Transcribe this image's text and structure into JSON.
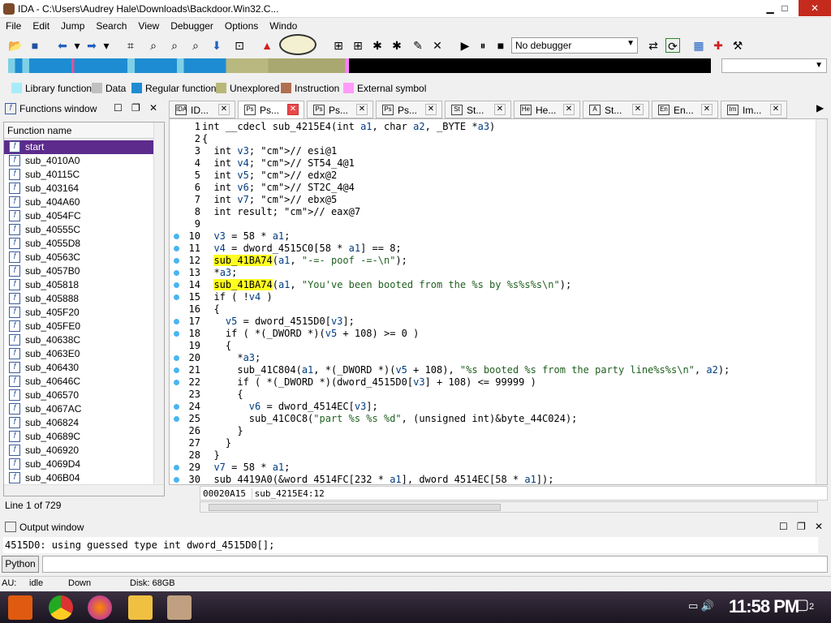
{
  "window": {
    "title": "IDA - C:\\Users\\Audrey Hale\\Downloads\\Backdoor.Win32.C...",
    "min": "▁",
    "max": "□",
    "close": "✕"
  },
  "menu": [
    "File",
    "Edit",
    "Jump",
    "Search",
    "View",
    "Debugger",
    "Options",
    "Windo"
  ],
  "toolbar": {
    "debugger": "No debugger"
  },
  "legend": [
    {
      "label": "Library function",
      "color": "#a8ecf8"
    },
    {
      "label": "Data",
      "color": "#c0c0c0"
    },
    {
      "label": "Regular function",
      "color": "#1e8cd2"
    },
    {
      "label": "Unexplored",
      "color": "#b8b878"
    },
    {
      "label": "Instruction",
      "color": "#b07050"
    },
    {
      "label": "External symbol",
      "color": "#ff9cf8"
    }
  ],
  "functions": {
    "title": "Functions window",
    "header": "Function name",
    "items": [
      "start",
      "sub_4010A0",
      "sub_40115C",
      "sub_403164",
      "sub_404A60",
      "sub_4054FC",
      "sub_40555C",
      "sub_4055D8",
      "sub_40563C",
      "sub_4057B0",
      "sub_405818",
      "sub_405888",
      "sub_405F20",
      "sub_405FE0",
      "sub_40638C",
      "sub_4063E0",
      "sub_406430",
      "sub_40646C",
      "sub_406570",
      "sub_4067AC",
      "sub_406824",
      "sub_40689C",
      "sub_406920",
      "sub_4069D4",
      "sub_406B04"
    ],
    "status": "Line 1 of 729"
  },
  "tabs": [
    {
      "label": "ID...",
      "icon": "IDA"
    },
    {
      "label": "Ps...",
      "icon": "Ps",
      "active": true
    },
    {
      "label": "Ps...",
      "icon": "Ps"
    },
    {
      "label": "Ps...",
      "icon": "Ps"
    },
    {
      "label": "St...",
      "icon": "St"
    },
    {
      "label": "He...",
      "icon": "He"
    },
    {
      "label": "St...",
      "icon": "A"
    },
    {
      "label": "En...",
      "icon": "En"
    },
    {
      "label": "Im...",
      "icon": "Im"
    }
  ],
  "code": {
    "lines": [
      "int __cdecl sub_4215E4(int a1, char a2, _BYTE *a3)",
      "{",
      "  int v3; // esi@1",
      "  int v4; // ST54_4@1",
      "  int v5; // edx@2",
      "  int v6; // ST2C_4@4",
      "  int v7; // ebx@5",
      "  int result; // eax@7",
      "",
      "  v3 = 58 * a1;",
      "  v4 = dword_4515C0[58 * a1] == 8;",
      "  sub_41BA74(a1, \"-=- poof -=-\\n\");",
      "  *a3;",
      "  sub_41BA74(a1, \"You've been booted from the %s by %s%s%s\\n\");",
      "  if ( !v4 )",
      "  {",
      "    v5 = dword_4515D0[v3];",
      "    if ( *(_DWORD *)(v5 + 108) >= 0 )",
      "    {",
      "      *a3;",
      "      sub_41C804(a1, *(_DWORD *)(v5 + 108), \"%s booted %s from the party line%s%s\\n\", a2);",
      "      if ( *(_DWORD *)(dword_4515D0[v3] + 108) <= 99999 )",
      "      {",
      "        v6 = dword_4514EC[v3];",
      "        sub_41C0C8(\"part %s %s %d\", (unsigned int)&byte_44C024);",
      "      }",
      "    }",
      "  }",
      "  v7 = 58 * a1;",
      "  sub_4419A0(&word_4514FC[232 * a1], dword_4514EC[58 * a1]);"
    ],
    "numbers": [
      "1",
      "2",
      "3",
      "4",
      "5",
      "6",
      "7",
      "8",
      "9",
      "10",
      "11",
      "12",
      "13",
      "14",
      "15",
      "16",
      "17",
      "18",
      "19",
      "20",
      "21",
      "22",
      "23",
      "24",
      "25",
      "26",
      "27",
      "28",
      "29",
      "30"
    ],
    "dotted": [
      10,
      11,
      12,
      13,
      14,
      15,
      17,
      18,
      20,
      21,
      22,
      24,
      25,
      29,
      30
    ],
    "status_addr": "00020A15",
    "status_func": "sub_4215E4:12"
  },
  "output": {
    "title": "Output window",
    "text": "4515D0: using guessed type int dword_4515D0[];",
    "python_label": "Python"
  },
  "statusbar": {
    "au": "AU:",
    "state": "idle",
    "dir": "Down",
    "disk": "Disk: 68GB"
  },
  "taskbar": {
    "clock": "11:58 PM",
    "notifications": "2"
  }
}
